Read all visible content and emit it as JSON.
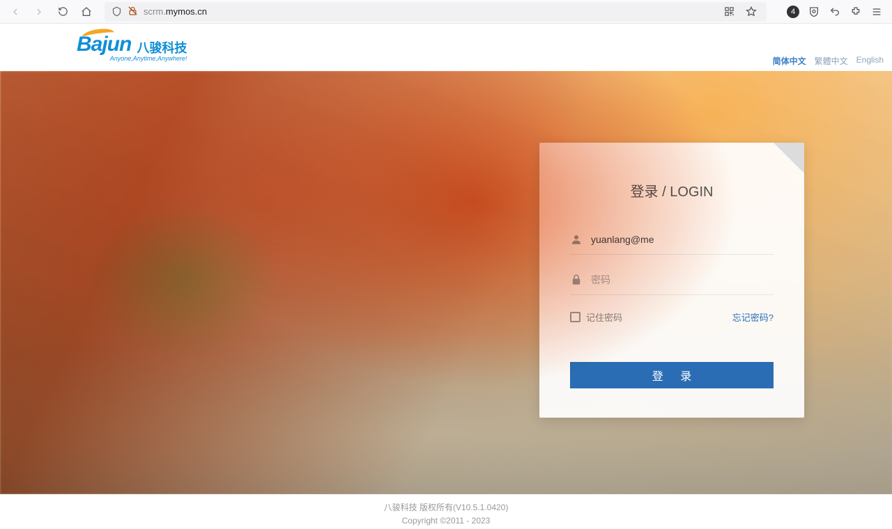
{
  "browser": {
    "url_prefix": "scrm.",
    "url_domain": "mymos.cn",
    "notification_count": "4"
  },
  "header": {
    "logo_main": "Bajun",
    "logo_cn": "八骏科技",
    "logo_tagline": "Anyone,Anytime,Anywhere!",
    "lang": {
      "zh_simplified": "简体中文",
      "zh_traditional": "繁體中文",
      "en": "English"
    }
  },
  "login": {
    "title": "登录 / LOGIN",
    "username_value": "yuanlang@me",
    "password_placeholder": "密码",
    "remember_label": "记住密码",
    "forgot_label": "忘记密码?",
    "submit_label": "登 录"
  },
  "footer": {
    "line1": "八骏科技 版权所有(V10.5.1.0420)",
    "line2": "Copyright ©2011 - 2023"
  }
}
